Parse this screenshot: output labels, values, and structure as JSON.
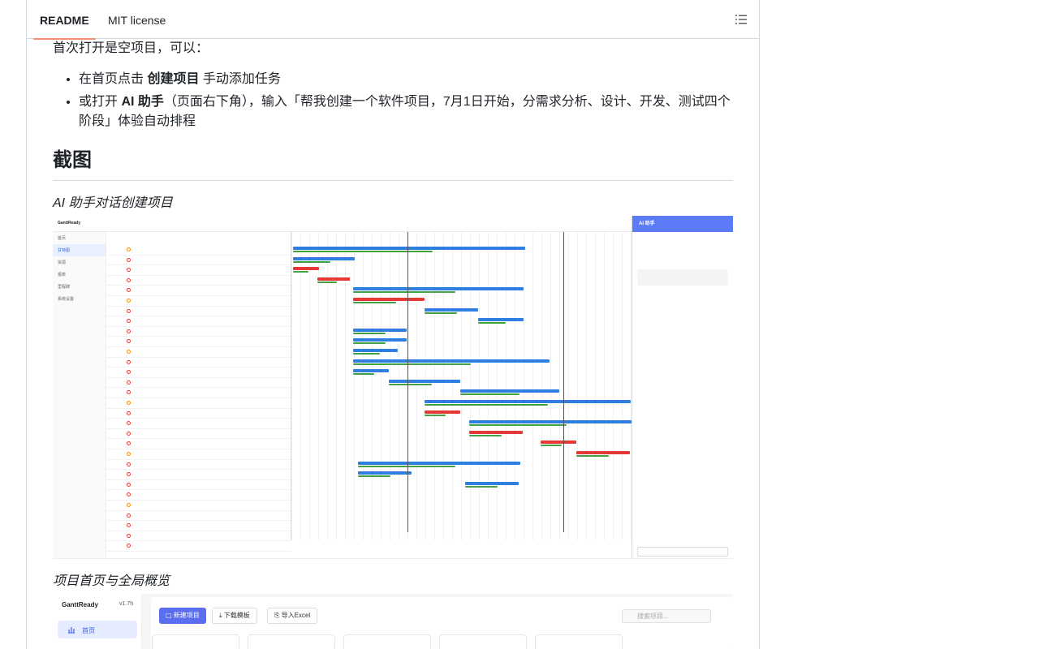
{
  "tabs": {
    "readme": "README",
    "license": "MIT license"
  },
  "intro": "首次打开是空项目，可以：",
  "bullets": [
    {
      "pre": "在首页点击 ",
      "bold": "创建项目",
      "post": " 手动添加任务"
    },
    {
      "pre": "或打开 ",
      "bold": "AI 助手",
      "post": "（页面右下角），输入「帮我创建一个软件项目，7月1日开始，分需求分析、设计、开发、测试四个阶段」体验自动排程"
    }
  ],
  "section_title": "截图",
  "captions": {
    "shot1": "AI 助手对话创建项目",
    "shot2": "项目首页与全局概览"
  },
  "shot1": {
    "app": "GanttReady",
    "ai_title": "AI 助手",
    "side_items": [
      "首页",
      "甘特图",
      "资源",
      "报表",
      "里程碑",
      "系统设置"
    ]
  },
  "shot2": {
    "brand": "GanttReady",
    "version": "v1.7h",
    "nav_home": "首页",
    "btn_create": "新建项目",
    "btn_template": "下载模板",
    "btn_import": "导入Excel",
    "search_placeholder": "搜索项目..."
  },
  "colors": {
    "tab_underline": "#fd8c73",
    "bar_blue": "#2f7fe0",
    "bar_green": "#43a047",
    "bar_red": "#e53935",
    "primary": "#5b6ef0"
  }
}
